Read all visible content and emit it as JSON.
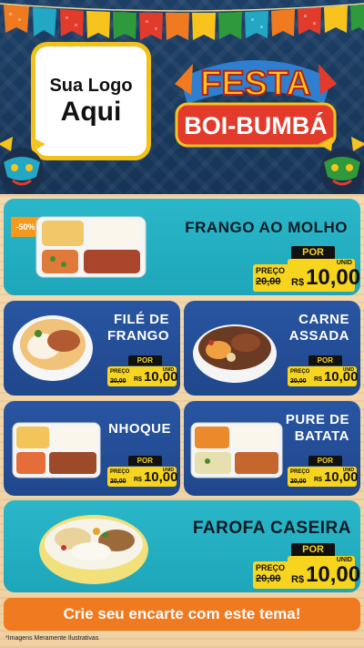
{
  "header": {
    "logo_line1": "Sua Logo",
    "logo_line2": "Aqui",
    "title_line1": "FESTA",
    "title_line2": "BOI-BUMBÁ"
  },
  "products": [
    {
      "name": "FRANGO AO MOLHO",
      "badge": "-50%",
      "por_label": "POR",
      "preco_label": "PREÇO",
      "old_price": "20,00",
      "currency": "R$",
      "price": "10,00",
      "unit": "UNID"
    },
    {
      "name_line1": "FILÉ DE",
      "name_line2": "FRANGO",
      "por_label": "POR",
      "preco_label": "PREÇO",
      "old_price": "20,00",
      "currency": "R$",
      "price": "10,00",
      "unit": "UNID"
    },
    {
      "name_line1": "CARNE",
      "name_line2": "ASSADA",
      "por_label": "POR",
      "preco_label": "PREÇO",
      "old_price": "20,00",
      "currency": "R$",
      "price": "10,00",
      "unit": "UNID"
    },
    {
      "name": "NHOQUE",
      "por_label": "POR",
      "preco_label": "PREÇO",
      "old_price": "20,00",
      "currency": "R$",
      "price": "10,00",
      "unit": "UNID"
    },
    {
      "name_line1": "PURE DE",
      "name_line2": "BATATA",
      "por_label": "POR",
      "preco_label": "PREÇO",
      "old_price": "20,00",
      "currency": "R$",
      "price": "10,00",
      "unit": "UNID"
    },
    {
      "name": "FAROFA CASEIRA",
      "por_label": "POR",
      "preco_label": "PREÇO",
      "old_price": "20,00",
      "currency": "R$",
      "price": "10,00",
      "unit": "UNID"
    }
  ],
  "cta": "Crie seu encarte com este tema!",
  "disclaimer": "*Imagens Meramente Ilustrativas",
  "colors": {
    "header_bg": "#1d3f66",
    "teal_card": "#2ab7c9",
    "blue_card": "#2855a2",
    "price_yellow": "#f7d51e",
    "cta_orange": "#f07a1f",
    "logo_border": "#f3c01a"
  }
}
